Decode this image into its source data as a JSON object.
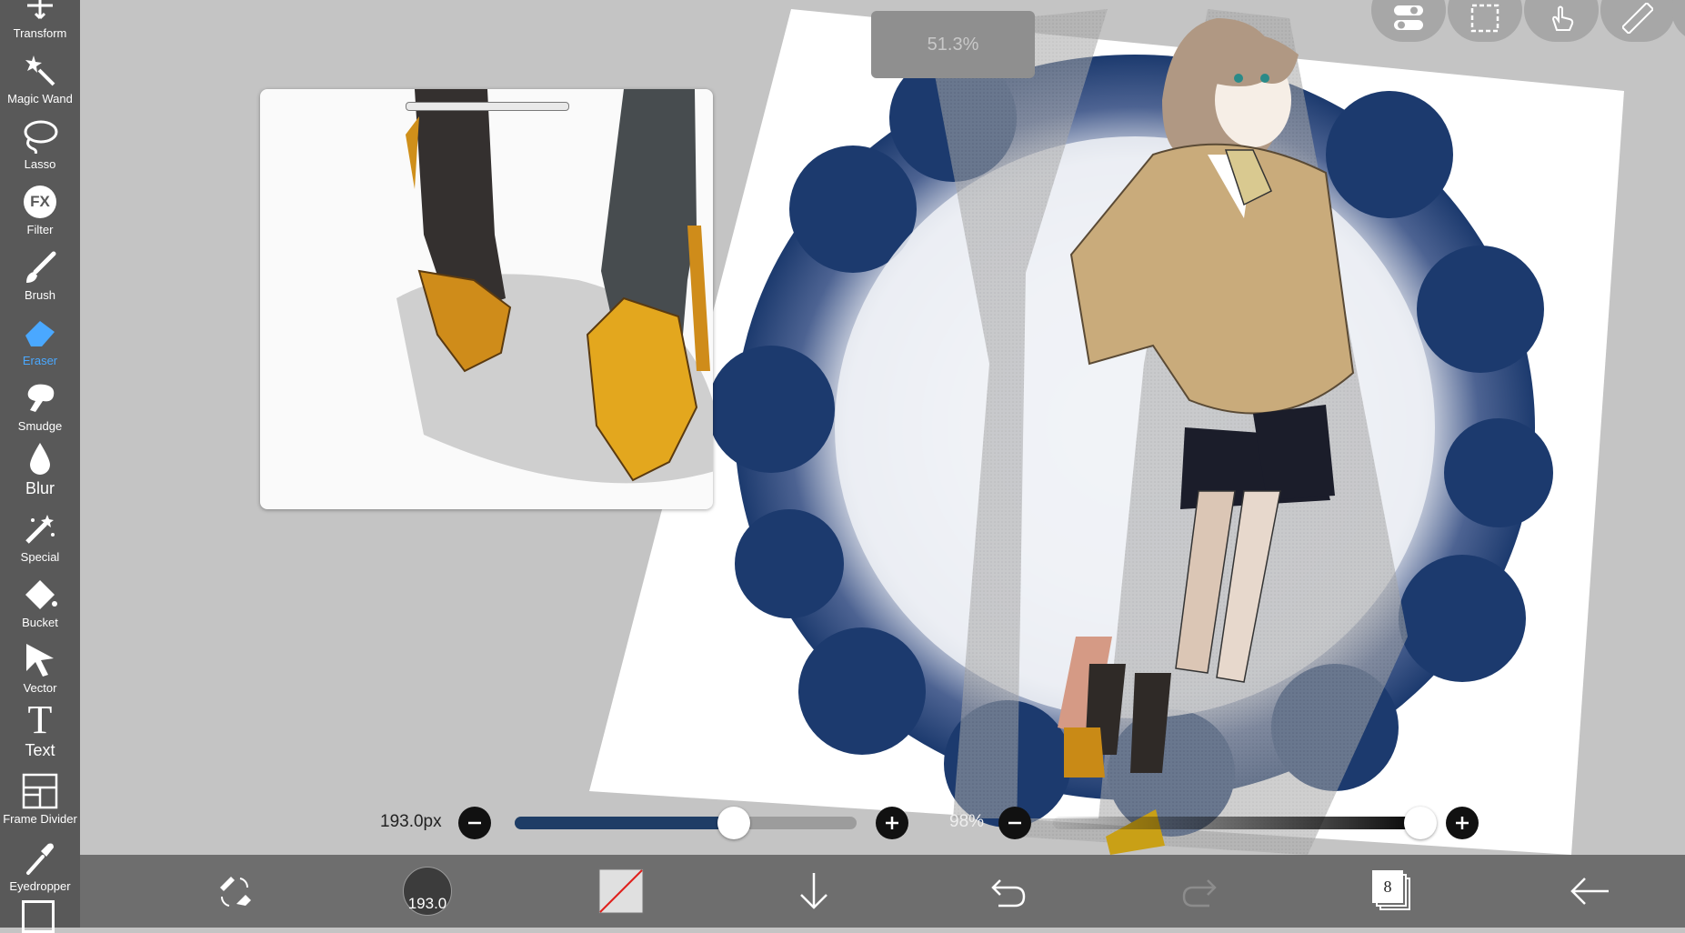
{
  "toolbar": {
    "items": [
      {
        "label": "Transform",
        "icon": "transform-icon"
      },
      {
        "label": "Magic Wand",
        "icon": "magic-wand-icon"
      },
      {
        "label": "Lasso",
        "icon": "lasso-icon"
      },
      {
        "label": "Filter",
        "icon": "filter-icon",
        "glyph": "FX"
      },
      {
        "label": "Brush",
        "icon": "brush-icon"
      },
      {
        "label": "Eraser",
        "icon": "eraser-icon"
      },
      {
        "label": "Smudge",
        "icon": "smudge-icon"
      },
      {
        "label": "Blur",
        "icon": "blur-icon"
      },
      {
        "label": "Special",
        "icon": "special-icon"
      },
      {
        "label": "Bucket",
        "icon": "bucket-icon"
      },
      {
        "label": "Vector",
        "icon": "vector-icon"
      },
      {
        "label": "Text",
        "icon": "text-icon",
        "glyph": "T"
      },
      {
        "label": "Frame Divider",
        "icon": "frame-divider-icon"
      },
      {
        "label": "Eyedropper",
        "icon": "eyedropper-icon"
      }
    ],
    "active": "Eraser",
    "active_color": "#4aa8ff"
  },
  "canvas": {
    "zoom": "51.3%"
  },
  "top_icons": [
    "layer-toggle-icon",
    "selection-icon",
    "touch-icon",
    "ruler-icon"
  ],
  "brush_size": {
    "value_label": "193.0px",
    "level": 0.64,
    "fill_color": "#1e3d66"
  },
  "opacity": {
    "value_label": "98%",
    "level": 0.98
  },
  "bottom_bar": {
    "brush_preview_value": "193.0",
    "layer_count": "8",
    "icons": [
      "tool-swap-icon",
      "brush-size-icon",
      "color-swatch-icon",
      "download-icon",
      "undo-icon",
      "redo-icon",
      "layers-icon",
      "back-arrow-icon"
    ]
  },
  "colors": {
    "sky_blue": "#1c3a6e",
    "toolbar_bg": "#595959",
    "bottom_bar_bg": "#6e6e6e",
    "canvas_bg": "#c4c4c4"
  }
}
